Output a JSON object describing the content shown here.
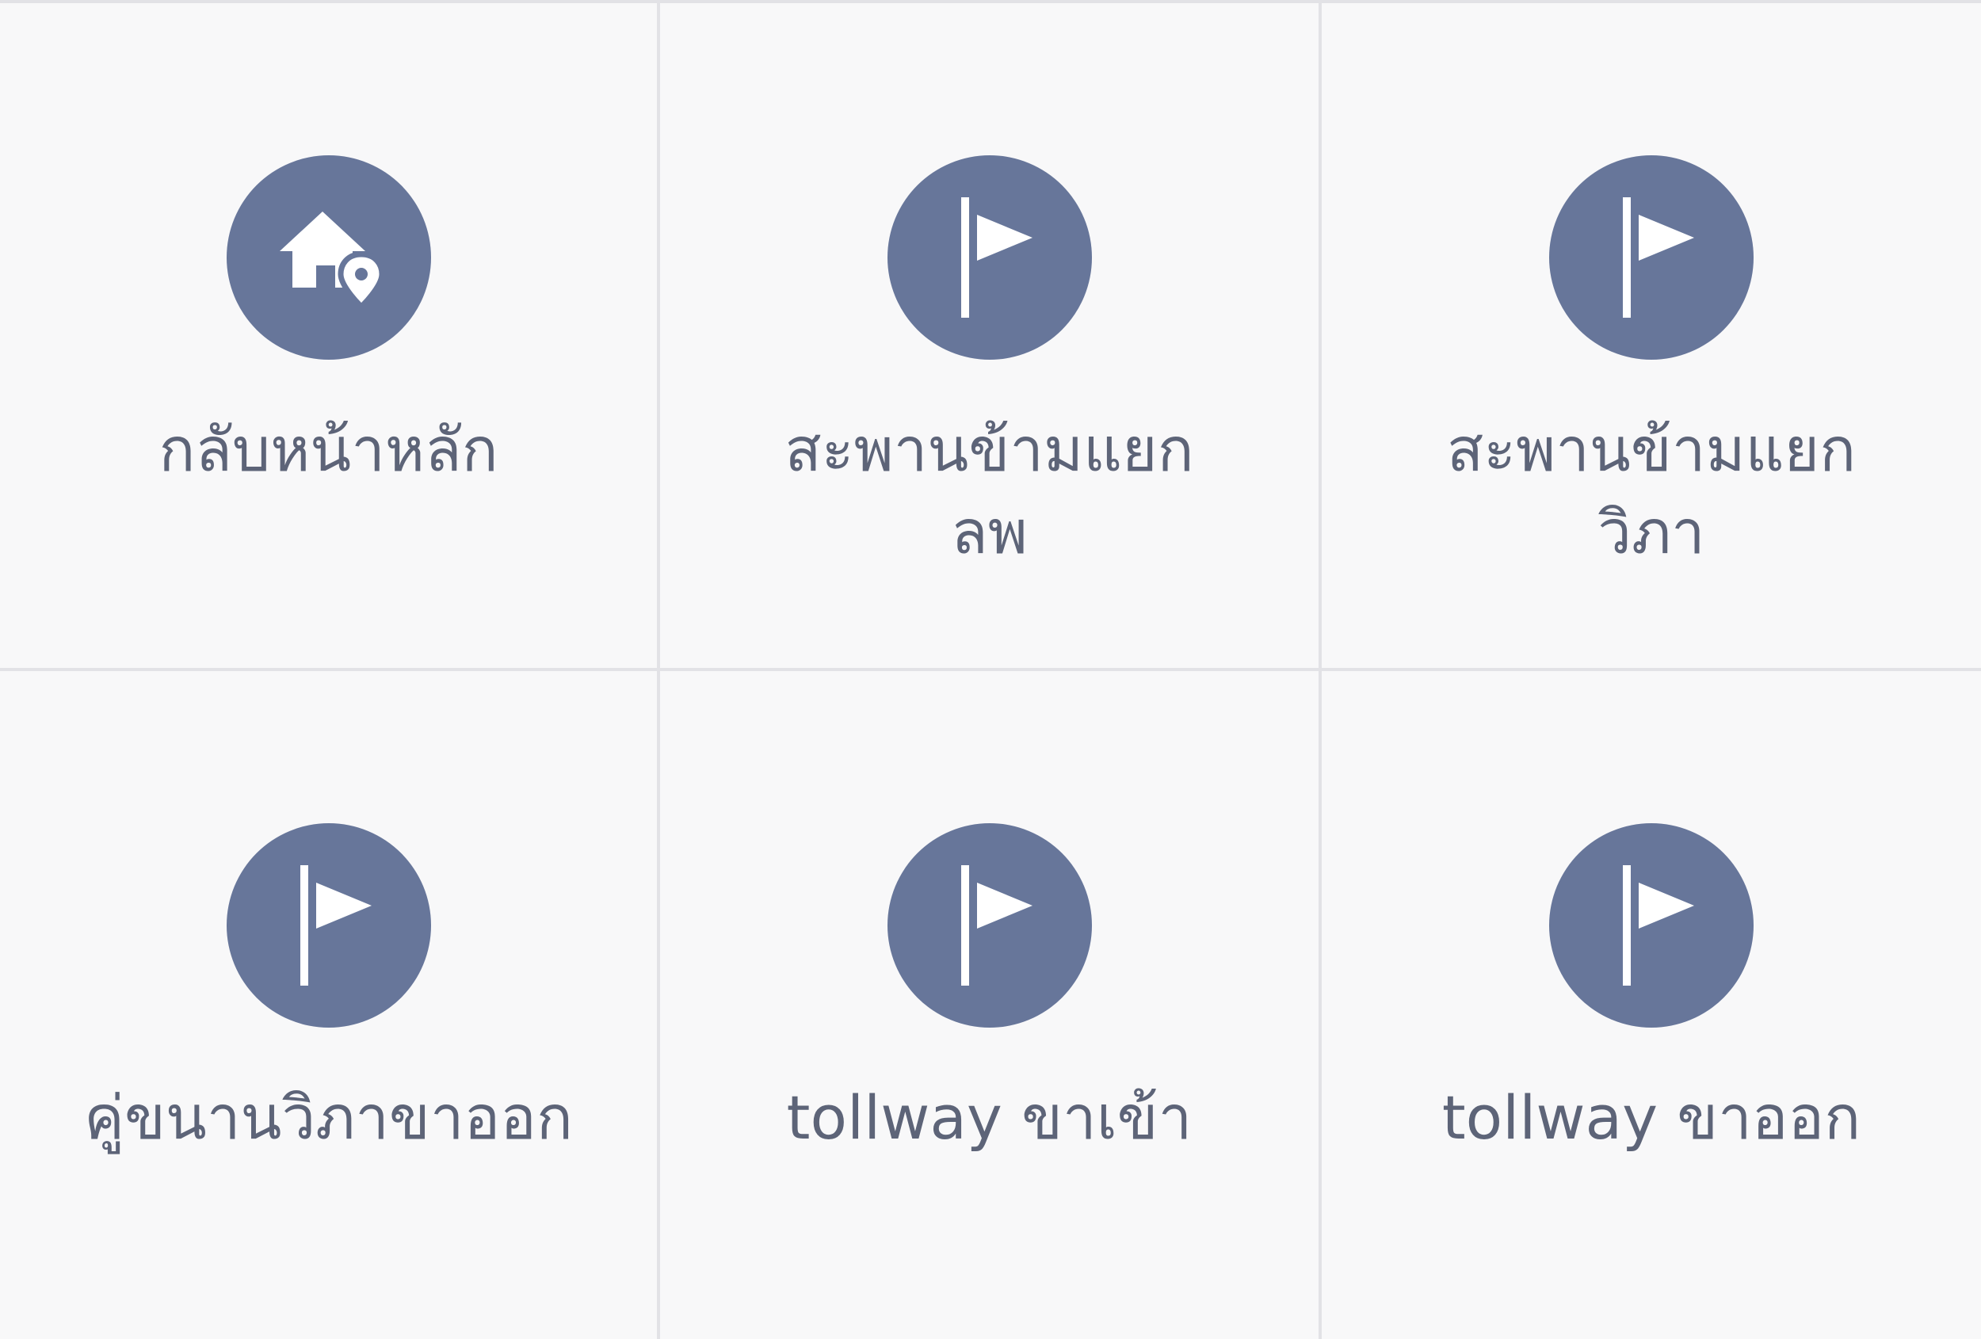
{
  "accent_color": "#67769a",
  "shortcuts": [
    {
      "label": "กลับหน้าหลัก",
      "icon": "home-location-icon"
    },
    {
      "label": "สะพานข้ามแยก\nลพ",
      "icon": "flag-icon"
    },
    {
      "label": "สะพานข้ามแยก\nวิภา",
      "icon": "flag-icon"
    },
    {
      "label": "คู่ขนานวิภาขาออก",
      "icon": "flag-icon"
    },
    {
      "label": "tollway ขาเข้า",
      "icon": "flag-icon"
    },
    {
      "label": "tollway ขาออก",
      "icon": "flag-icon"
    }
  ]
}
